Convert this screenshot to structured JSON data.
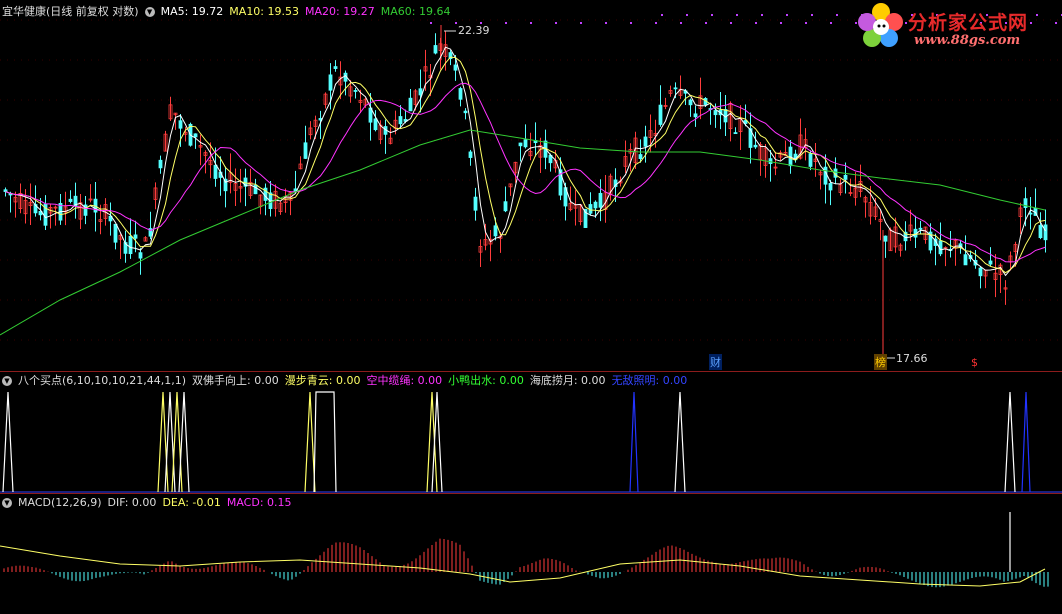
{
  "main_header": {
    "stock": "宜华健康(日线 前复权 对数)",
    "ma5": "MA5: 19.72",
    "ma10": "MA10: 19.53",
    "ma20": "MA20: 19.27",
    "ma60": "MA60: 19.64"
  },
  "price_labels": {
    "high": "22.39",
    "low": "17.66"
  },
  "event_marks": {
    "cai": "财",
    "bang": "榜",
    "dollar": "$"
  },
  "indicator_header": {
    "name": "八个买点(6,10,10,10,21,44,1,1)",
    "v1": "双佛手向上: 0.00",
    "v2": "漫步青云: 0.00",
    "v3": "空中缆绳: 0.00",
    "v4": "小鸭出水: 0.00",
    "v5": "海底捞月: 0.00",
    "v6": "无敌照明: 0.00"
  },
  "macd_header": {
    "name": "MACD(12,26,9)",
    "dif": "DIF: 0.00",
    "dea": "DEA: -0.01",
    "macd": "MACD: 0.15"
  },
  "watermark": {
    "title": "分析家公式网",
    "url": "www.88gs.com"
  },
  "colors": {
    "up": "#ff3c3c",
    "down": "#54ffff",
    "ma5": "#ffffff",
    "ma10": "#ffff66",
    "ma20": "#ff33ff",
    "ma60": "#33cc33",
    "separator": "#8c1c1c"
  }
}
